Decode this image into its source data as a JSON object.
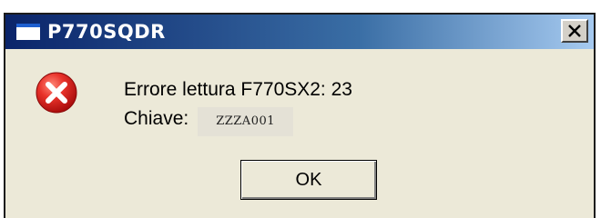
{
  "window": {
    "title": "P770SQDR",
    "close_label": "X"
  },
  "message": {
    "error_text": "Errore lettura F770SX2: 23",
    "key_label": "Chiave:",
    "key_value": "ZZZA001",
    "icon": "error-icon"
  },
  "buttons": {
    "ok_label": "OK"
  },
  "colors": {
    "titlebar_start": "#0a246a",
    "titlebar_end": "#a6caf0",
    "dialog_background": "#ece9d8",
    "error_red": "#d8261c"
  }
}
